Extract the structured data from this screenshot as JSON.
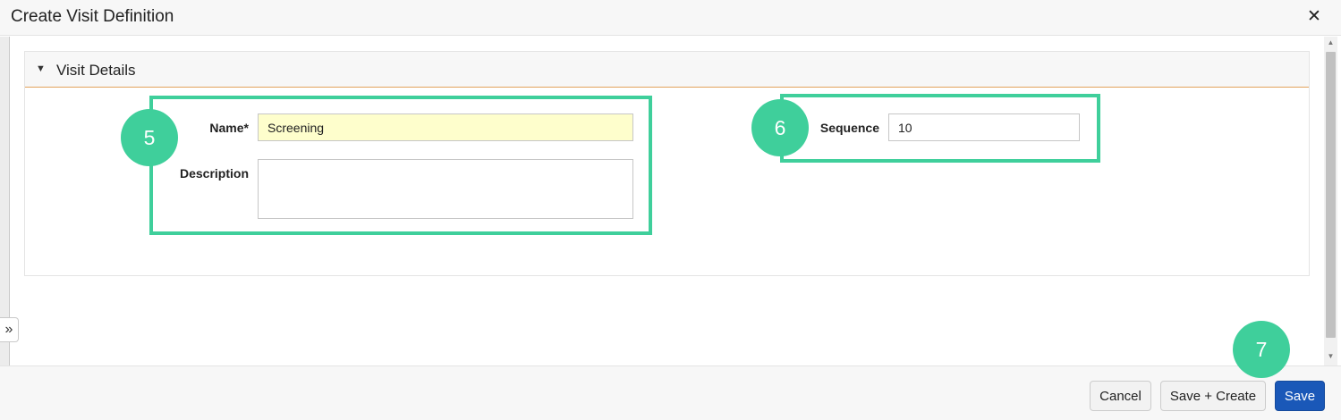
{
  "dialog": {
    "title": "Create Visit Definition",
    "close_glyph": "✕"
  },
  "section": {
    "title": "Visit Details",
    "caret_glyph": "▼"
  },
  "form": {
    "name_label": "Name*",
    "name_value": "Screening",
    "description_label": "Description",
    "description_value": "",
    "sequence_label": "Sequence",
    "sequence_value": "10"
  },
  "annotations": {
    "step_5": "5",
    "step_6": "6",
    "step_7": "7",
    "color": "#3fcf9b"
  },
  "footer": {
    "cancel_label": "Cancel",
    "save_create_label": "Save + Create",
    "save_label": "Save"
  },
  "sidebar": {
    "expand_glyph": "»"
  },
  "colors": {
    "primary": "#1a58b8",
    "section_rule": "#e2a35c",
    "required_field_bg": "#fefecc"
  }
}
